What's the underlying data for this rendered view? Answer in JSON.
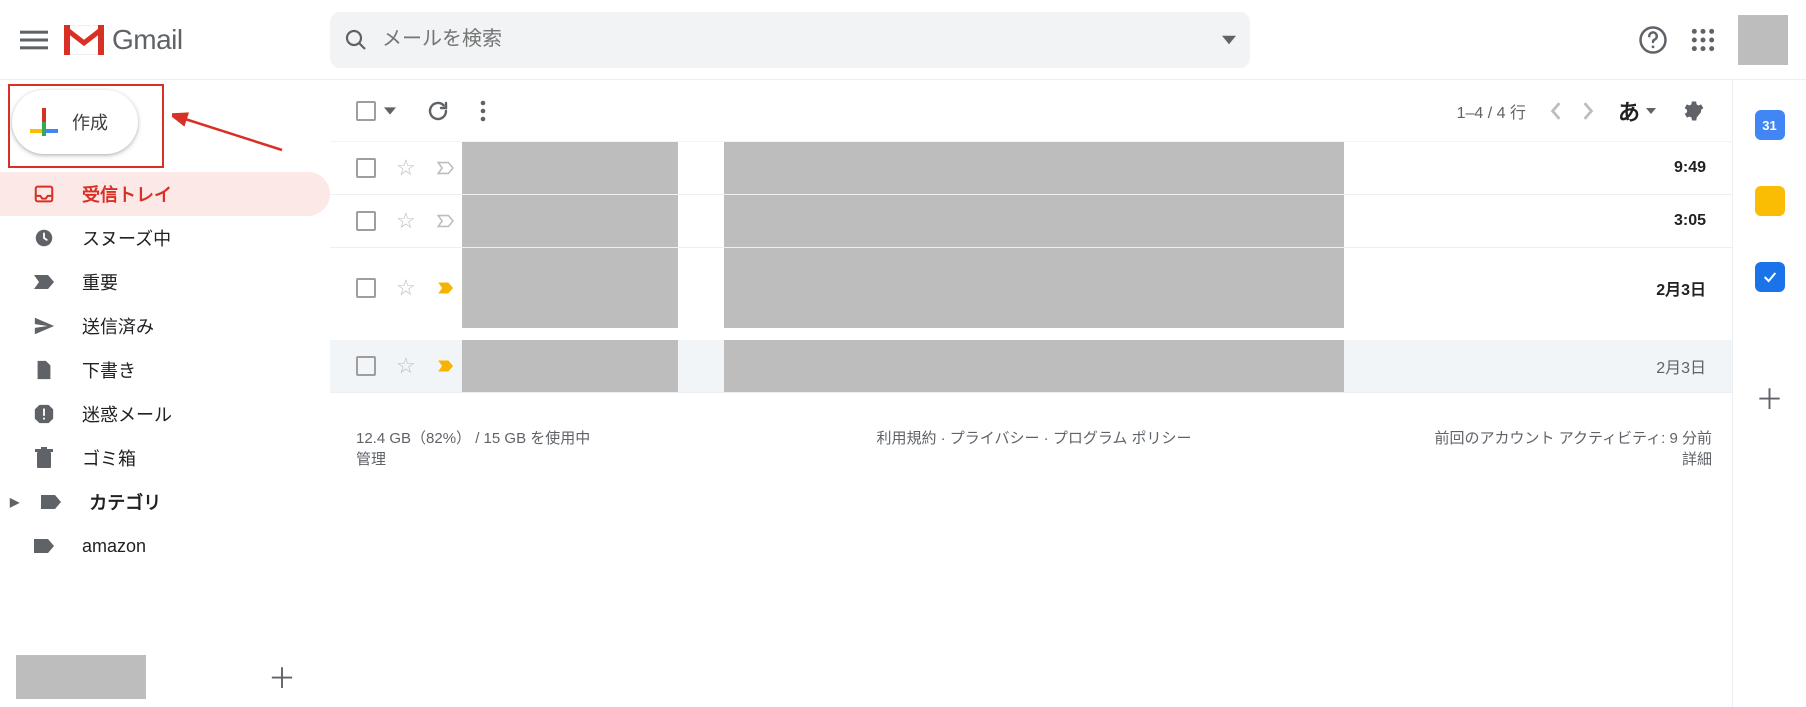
{
  "header": {
    "brand": "Gmail",
    "search_placeholder": "メールを検索"
  },
  "compose": {
    "label": "作成"
  },
  "sidebar": {
    "items": [
      {
        "label": "受信トレイ",
        "icon": "inbox"
      },
      {
        "label": "スヌーズ中",
        "icon": "clock"
      },
      {
        "label": "重要",
        "icon": "important"
      },
      {
        "label": "送信済み",
        "icon": "send"
      },
      {
        "label": "下書き",
        "icon": "draft"
      },
      {
        "label": "迷惑メール",
        "icon": "spam"
      },
      {
        "label": "ゴミ箱",
        "icon": "trash"
      },
      {
        "label": "カテゴリ",
        "icon": "label"
      },
      {
        "label": "amazon",
        "icon": "label"
      }
    ]
  },
  "toolbar": {
    "range": "1–4 / 4 行",
    "ime": "あ"
  },
  "messages": [
    {
      "time": "9:49",
      "read": false,
      "important": false
    },
    {
      "time": "3:05",
      "read": false,
      "important": false
    },
    {
      "time": "2月3日",
      "read": false,
      "important": true
    },
    {
      "time": "2月3日",
      "read": true,
      "important": true
    }
  ],
  "footer": {
    "storage_line1": "12.4 GB（82%） / 15 GB を使用中",
    "storage_line2": "管理",
    "center": "利用規約 · プライバシー · プログラム ポリシー",
    "right_line1": "前回のアカウント アクティビティ: 9 分前",
    "right_line2": "詳細"
  },
  "rside": {
    "cal": "31"
  }
}
